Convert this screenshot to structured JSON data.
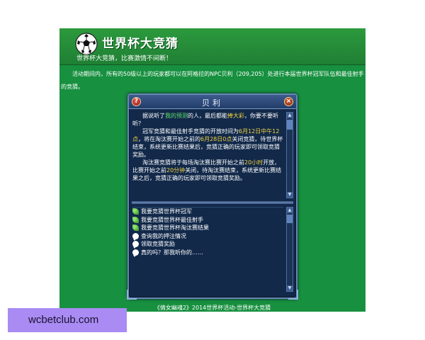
{
  "banner": {
    "title": "世界杯大竞猜",
    "subtitle": "世界杯大竞猜，比赛激情不间断！"
  },
  "intro": "活动期间内，所有的50级以上的玩家都可以在阿格拉的NPC贝利（209,205）处进行本届世界杯冠军队伍和最佳射手的竞猜。",
  "dialog": {
    "title": "贝利",
    "help_label": "?",
    "close_label": "×",
    "message": {
      "p1_a": "据说听了",
      "p1_link": "我的预测",
      "p1_b": "的人，最后都能",
      "p1_hl": "捧大彩",
      "p1_c": "，你要不要听听？",
      "p2_a": "冠军竞猜和最佳射手竞猜的开放时间为",
      "p2_hl1": "6月12日中午12点",
      "p2_b": "，将在淘汰赛开始之前的",
      "p2_hl2": "6月28日0点",
      "p2_c": "关闭竞猜，待世界杯结束，系统更新比赛结果后，竞猜正确的玩家即可领取竞猜奖励。",
      "p3_a": "淘汰赛竞猜将于每场淘汰赛比赛开始之前",
      "p3_hl1": "20小时",
      "p3_b": "开放，比赛开始之前",
      "p3_hl2": "20分钟",
      "p3_c": "关闭，待淘汰赛结束，系统更新比赛结果之后，竞猜正确的玩家即可领取竞猜奖励。"
    },
    "options": [
      {
        "label": "我要竞猜世界杯冠军",
        "icon": "leaf-icon"
      },
      {
        "label": "我要竞猜世界杯最佳射手",
        "icon": "leaf-icon"
      },
      {
        "label": "我要竞猜世界杯淘汰赛结果",
        "icon": "leaf-icon"
      },
      {
        "label": "查询我的押注情况",
        "icon": "speech-bubble-icon"
      },
      {
        "label": "领取竞猜奖励",
        "icon": "speech-bubble-icon"
      },
      {
        "label": "真的吗？那我听你的……",
        "icon": "speech-bubble-icon"
      }
    ]
  },
  "footer": "《倩女幽魂2》2014世界杯活动-世界杯大竞猜",
  "watermark": "wcbetclub.com",
  "colors": {
    "page_green": "#17903f",
    "dialog_bg": "#12294a",
    "highlight_green": "#5fe06b",
    "highlight_yellow": "#f3d23d",
    "watermark_bg": "#a98bf3"
  }
}
